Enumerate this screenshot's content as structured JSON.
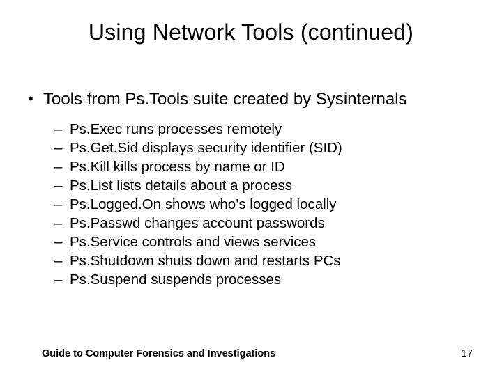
{
  "title": "Using Network Tools (continued)",
  "bullet_main": "Tools from Ps.Tools suite created by Sysinternals",
  "sub": [
    "Ps.Exec runs processes remotely",
    "Ps.Get.Sid displays security identifier (SID)",
    "Ps.Kill kills process by name or ID",
    "Ps.List lists details about a process",
    "Ps.Logged.On shows who’s logged locally",
    "Ps.Passwd changes account passwords",
    "Ps.Service controls and views services",
    "Ps.Shutdown shuts down and restarts PCs",
    "Ps.Suspend suspends processes"
  ],
  "footer": "Guide to Computer Forensics and Investigations",
  "page": "17",
  "marks": {
    "dot": "•",
    "dash": "–"
  }
}
